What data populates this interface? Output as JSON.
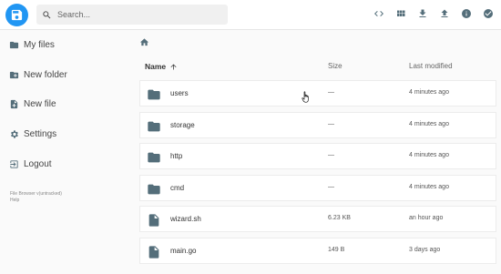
{
  "header": {
    "search_placeholder": "Search...",
    "actions": [
      {
        "name": "code-toggle-icon",
        "symbol": "<>"
      },
      {
        "name": "grid-view-icon"
      },
      {
        "name": "download-icon"
      },
      {
        "name": "upload-icon"
      },
      {
        "name": "info-icon"
      },
      {
        "name": "select-check-icon"
      }
    ]
  },
  "sidebar": {
    "items": [
      {
        "label": "My files",
        "icon": "folder-icon"
      },
      {
        "label": "New folder",
        "icon": "new-folder-icon"
      },
      {
        "label": "New file",
        "icon": "new-file-icon"
      },
      {
        "label": "Settings",
        "icon": "settings-icon"
      },
      {
        "label": "Logout",
        "icon": "logout-icon"
      }
    ],
    "footer_lines": [
      "File Browser v(untracked)",
      "Help"
    ]
  },
  "listing": {
    "headers": {
      "name": "Name",
      "size": "Size",
      "modified": "Last modified"
    },
    "sort": "ascending",
    "rows": [
      {
        "type": "folder",
        "name": "users",
        "size": "—",
        "modified": "4 minutes ago"
      },
      {
        "type": "folder",
        "name": "storage",
        "size": "—",
        "modified": "4 minutes ago"
      },
      {
        "type": "folder",
        "name": "http",
        "size": "—",
        "modified": "4 minutes ago"
      },
      {
        "type": "folder",
        "name": "cmd",
        "size": "—",
        "modified": "4 minutes ago"
      },
      {
        "type": "file",
        "name": "wizard.sh",
        "size": "6.23 KB",
        "modified": "an hour ago"
      },
      {
        "type": "file",
        "name": "main.go",
        "size": "149 B",
        "modified": "3 days ago"
      }
    ]
  },
  "colors": {
    "accent": "#2196f3",
    "icon_gray": "#546e7a",
    "header_icon": "#546e7a"
  }
}
